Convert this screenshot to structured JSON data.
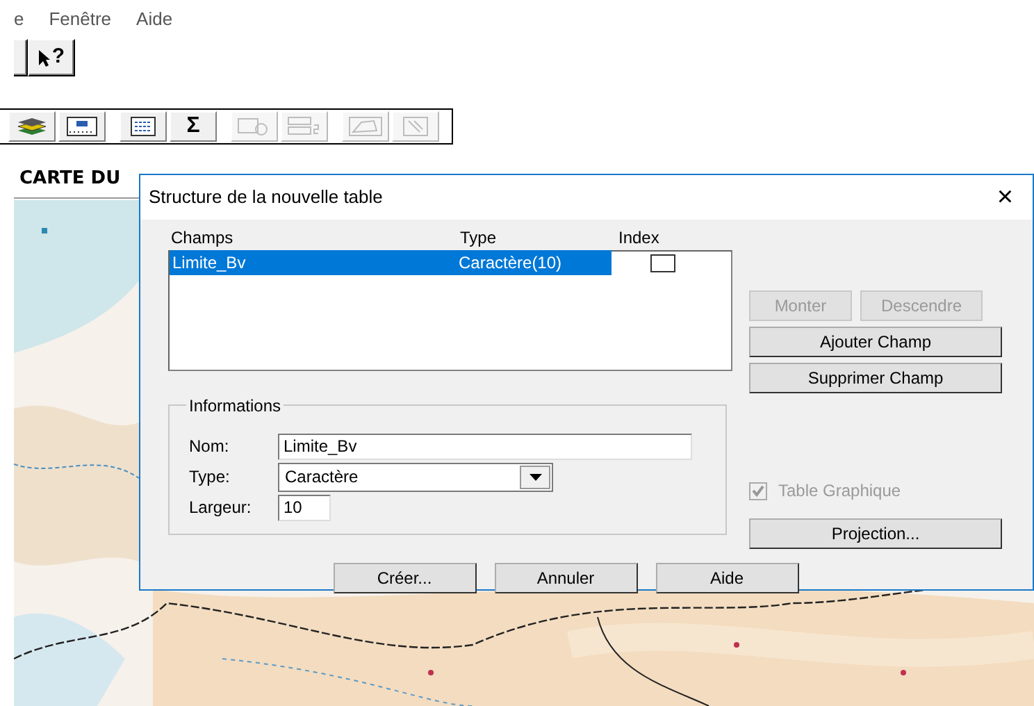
{
  "menu": [
    {
      "label": "e"
    },
    {
      "label": "Fenêtre"
    },
    {
      "label": "Aide"
    }
  ],
  "toolbar_top": [
    {
      "kind": "blank"
    },
    {
      "kind": "help",
      "text": "?"
    }
  ],
  "toolbar": [
    {
      "kind": "layers",
      "disabled": false
    },
    {
      "kind": "numbers",
      "disabled": false
    },
    {
      "kind": "table",
      "disabled": false
    },
    {
      "kind": "sigma",
      "text": "Σ",
      "disabled": false
    },
    {
      "kind": "chart",
      "disabled": true
    },
    {
      "kind": "columns",
      "disabled": true
    },
    {
      "kind": "polygon",
      "disabled": true
    },
    {
      "kind": "page",
      "disabled": true
    }
  ],
  "map_title": "CARTE DU",
  "dialog": {
    "title": "Structure de la nouvelle table",
    "close": "×",
    "columns": [
      "Champs",
      "Type",
      "Index"
    ],
    "rows": [
      {
        "name": "Limite_Bv",
        "type": "Caractère(10)",
        "index": false,
        "selected": true
      }
    ],
    "side_buttons": [
      {
        "label": "Monter",
        "disabled": true
      },
      {
        "label": "Descendre",
        "disabled": true
      },
      {
        "label": "Ajouter Champ",
        "disabled": false
      },
      {
        "label": "Supprimer Champ",
        "disabled": false
      }
    ],
    "group_title": "Informations",
    "fields": [
      {
        "kind": "text",
        "label": "Nom:",
        "value": "Limite_Bv"
      },
      {
        "kind": "select",
        "label": "Type:",
        "value": "Caractère"
      },
      {
        "kind": "short",
        "label": "Largeur:",
        "value": "10"
      }
    ],
    "graphic_table": {
      "label": "Table Graphique",
      "checked": true,
      "disabled": true
    },
    "projection": "Projection...",
    "buttons": [
      "Créer...",
      "Annuler",
      "Aide"
    ]
  }
}
